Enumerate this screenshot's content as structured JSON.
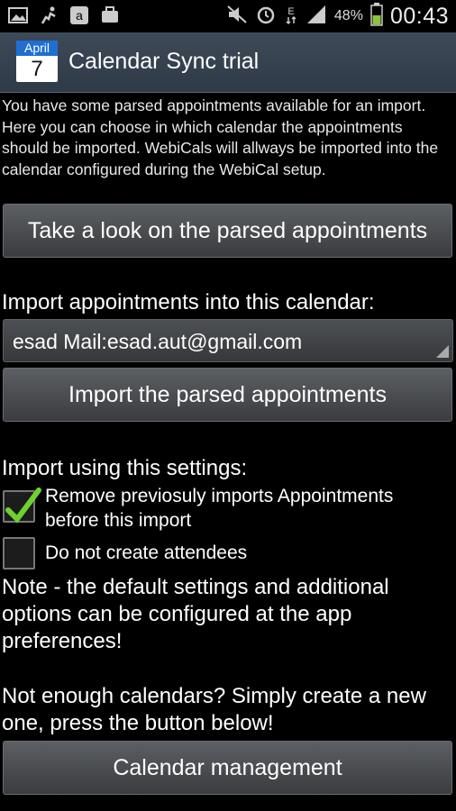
{
  "status_bar": {
    "icons_left": [
      "gallery-icon",
      "activity-icon",
      "amazon-icon",
      "briefcase-icon"
    ],
    "icons_right": [
      "mute-icon",
      "alarm-icon",
      "data-e-icon",
      "signal-icon"
    ],
    "battery": "48%",
    "time": "00:43"
  },
  "header": {
    "icon_month": "April",
    "icon_day": "7",
    "title": "Calendar Sync trial"
  },
  "intro_text": "You have some parsed appointments available for an import. Here you can choose in which calendar the appointments should be imported. WebiCals will allways be imported into the calendar configured during the WebiCal setup.",
  "buttons": {
    "look": "Take a look on the parsed appointments",
    "import": "Import the parsed appointments",
    "calendar_mgmt": "Calendar management"
  },
  "calendar_label": "Import appointments into this calendar:",
  "calendar_selected": "esad Mail:esad.aut@gmail.com",
  "settings_label": "Import using this settings:",
  "checkboxes": [
    {
      "label": "Remove previosuly imports Appointments before this import",
      "checked": true
    },
    {
      "label": "Do not create attendees",
      "checked": false
    }
  ],
  "note_text": "Note - the default settings and additional options can be configured at the app preferences!",
  "calendars_text": "Not enough calendars? Simply create a new one, press the button below!",
  "colors": {
    "accent_check": "#6fd12f",
    "titlebar": "#36414e"
  }
}
